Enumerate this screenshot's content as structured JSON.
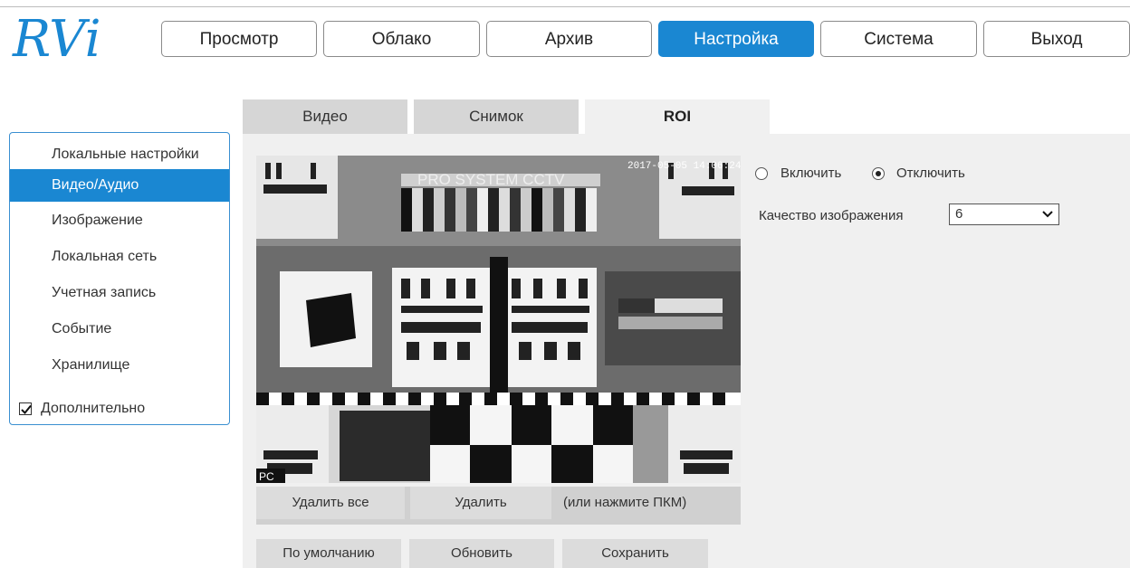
{
  "nav": {
    "items": [
      {
        "label": "Просмотр"
      },
      {
        "label": "Облако"
      },
      {
        "label": "Архив"
      },
      {
        "label": "Настройка"
      },
      {
        "label": "Система"
      },
      {
        "label": "Выход"
      }
    ],
    "active": "Настройка"
  },
  "logo": {
    "text": "RVi"
  },
  "tabs": {
    "items": [
      {
        "label": "Видео"
      },
      {
        "label": "Снимок"
      },
      {
        "label": "ROI"
      }
    ],
    "active": "ROI"
  },
  "sidebar": {
    "items": [
      {
        "label": "Локальные настройки"
      },
      {
        "label": "Видео/Аудио"
      },
      {
        "label": "Изображение"
      },
      {
        "label": "Локальная сеть"
      },
      {
        "label": "Учетная запись"
      },
      {
        "label": "Событие"
      },
      {
        "label": "Хранилище"
      }
    ],
    "active": "Видео/Аудио",
    "advanced": {
      "label": "Дополнительно",
      "checked": true
    }
  },
  "video": {
    "timestamp": "2017-05-05 14:06:24",
    "brand": "PRO SYSTEM CCTV",
    "corner": "PC"
  },
  "video_actions": {
    "delete_all": "Удалить все",
    "delete": "Удалить",
    "hint": "(или нажмите ПКМ)"
  },
  "roi": {
    "enable_label": "Включить",
    "disable_label": "Отключить",
    "selected": "Отключить",
    "quality_label": "Качество изображения",
    "quality_value": "6"
  },
  "footer": {
    "default": "По умолчанию",
    "refresh": "Обновить",
    "save": "Сохранить"
  },
  "colors": {
    "accent": "#1a87d2",
    "panel": "#f0f0f0"
  },
  "icons": [
    "chevron-down-icon",
    "checkbox-checked-icon"
  ]
}
